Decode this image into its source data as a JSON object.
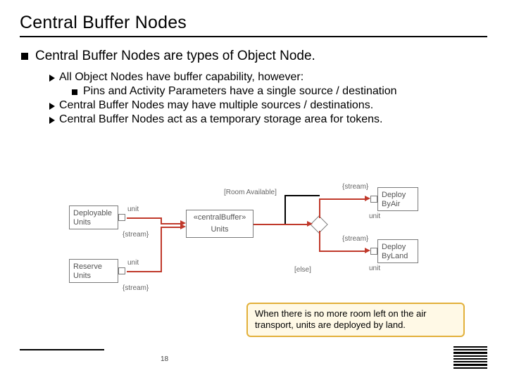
{
  "title": "Central Buffer Nodes",
  "bullets": {
    "main": "Central Buffer Nodes are types of Object Node.",
    "sub1": "All Object Nodes have buffer capability, however:",
    "sub1a": "Pins and Activity Parameters have a single source / destination",
    "sub2": "Central Buffer Nodes may have multiple sources / destinations.",
    "sub3": "Central Buffer Nodes act as a temporary storage area for tokens."
  },
  "diagram": {
    "deployable": "Deployable\nUnits",
    "reserve": "Reserve\nUnits",
    "central_stereo": "«centralBuffer»",
    "central_label": "Units",
    "deploy_air": "Deploy\nByAir",
    "deploy_land": "Deploy\nByLand",
    "pin_unit1": "unit",
    "pin_unit2": "unit",
    "pin_unit3": "unit",
    "pin_unit4": "unit",
    "guard_room": "[Room Available]",
    "guard_else": "[else]",
    "stream1": "{stream}",
    "stream2": "{stream}",
    "stream3": "{stream}",
    "stream4": "{stream}"
  },
  "note": "When there is no more room left on the air transport, units are deployed by land.",
  "page": "18",
  "logo": "IBM"
}
